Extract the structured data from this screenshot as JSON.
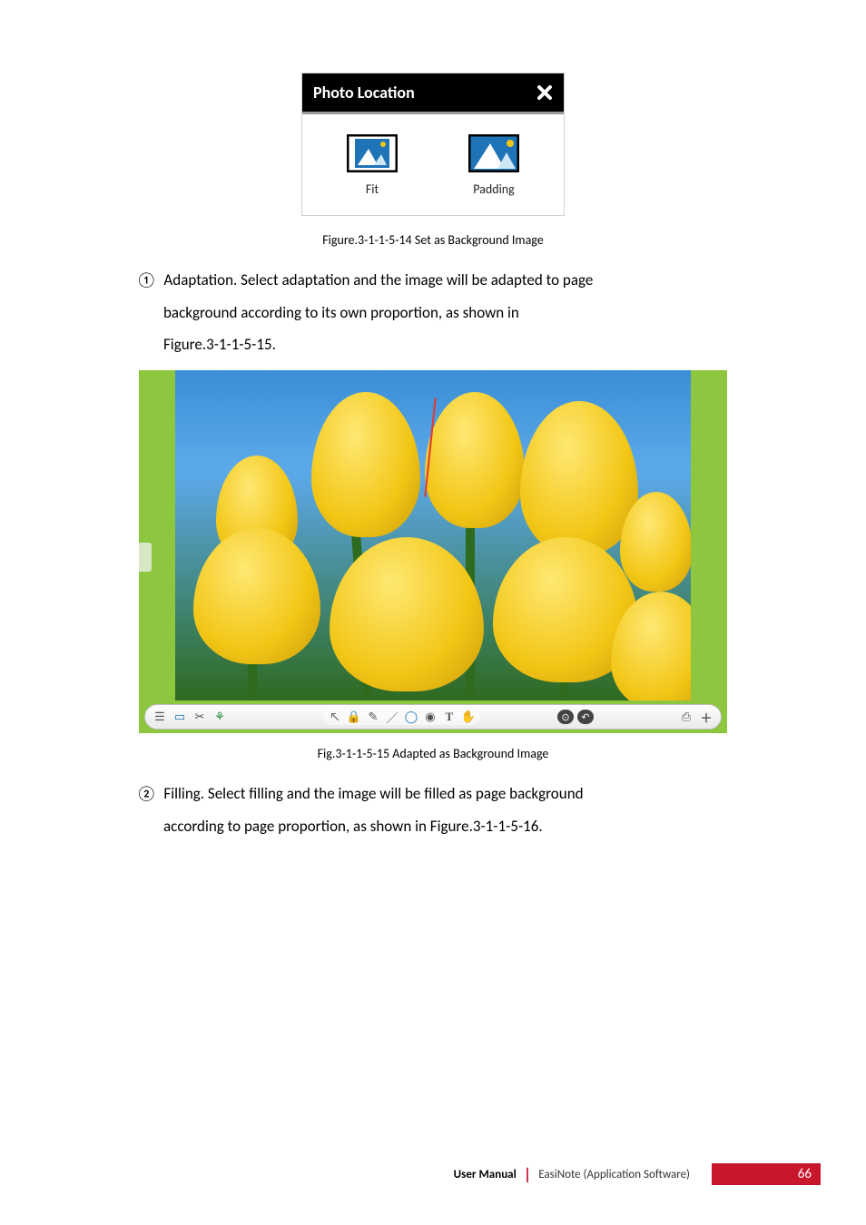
{
  "dialog": {
    "title": "Photo Location",
    "options": {
      "fit": "Fit",
      "padding": "Padding"
    }
  },
  "captions": {
    "fig14": "Figure.3-1-1-5-14 Set as Background Image",
    "fig15": "Fig.3-1-1-5-15 Adapted as Background Image"
  },
  "items": {
    "one_num": "①",
    "one_text_a": "Adaptation. Select adaptation and the image will be adapted to page",
    "one_text_b": "background according to its own proportion, as shown in",
    "one_text_c": "Figure.3-1-1-5-15.",
    "two_num": "②",
    "two_text_a": "Filling. Select filling and the image will be filled as page background",
    "two_text_b": "according to page proportion, as shown in Figure.3-1-1-5-16."
  },
  "toolbar": {
    "t_text": "T"
  },
  "footer": {
    "user_manual": "User Manual",
    "product": "EasiNote (Application Software)",
    "page": "66"
  }
}
